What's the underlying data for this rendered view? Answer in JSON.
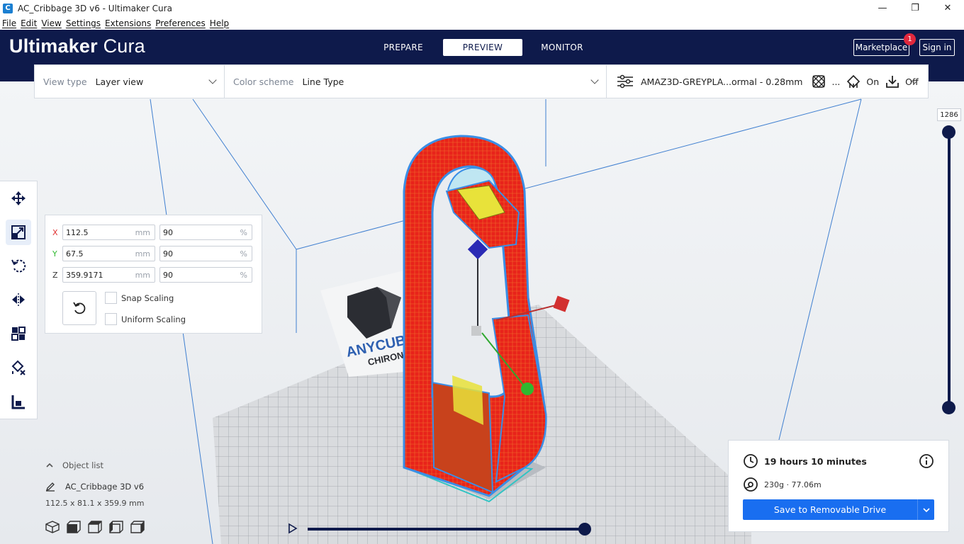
{
  "window": {
    "title": "AC_Cribbage 3D v6 - Ultimaker Cura",
    "app_icon": "C",
    "controls": {
      "minimize": "—",
      "maximize": "❐",
      "close": "✕"
    }
  },
  "menu": [
    "File",
    "Edit",
    "View",
    "Settings",
    "Extensions",
    "Preferences",
    "Help"
  ],
  "header": {
    "brand_bold": "Ultimaker",
    "brand_light": "Cura",
    "stages": [
      "PREPARE",
      "PREVIEW",
      "MONITOR"
    ],
    "active_stage": "PREVIEW",
    "marketplace_label": "Marketplace",
    "marketplace_badge": "1",
    "signin_label": "Sign in"
  },
  "viewbar": {
    "view_type_label": "View type",
    "view_type_value": "Layer view",
    "color_scheme_label": "Color scheme",
    "color_scheme_value": "Line Type",
    "profile": "AMAZ3D-GREYPLA...ormal - 0.28mm",
    "infill_value": "...",
    "support_value": "On",
    "adhesion_value": "Off"
  },
  "scale_tool": {
    "x_label": "X",
    "x_mm": "112.5",
    "x_pct": "90",
    "y_label": "Y",
    "y_mm": "67.5",
    "y_pct": "90",
    "z_label": "Z",
    "z_mm": "359.9171",
    "z_pct": "90",
    "unit_mm": "mm",
    "unit_pct": "%",
    "snap_scaling": "Snap Scaling",
    "uniform_scaling": "Uniform Scaling",
    "axis_colors": {
      "x": "#e03030",
      "y": "#2fb82f",
      "z": "#333333"
    }
  },
  "layer_slider": {
    "current_layer": "1286"
  },
  "object_list": {
    "toggle_label": "Object list",
    "object_name": "AC_Cribbage 3D v6",
    "dimensions": "112.5 x 81.1 x 359.9 mm"
  },
  "print_info": {
    "time": "19 hours 10 minutes",
    "material": "230g · 77.06m",
    "save_label": "Save to Removable Drive"
  },
  "build_plate_logo": {
    "line1": "ANYCUBIC",
    "line2": "CHIRON"
  },
  "colors": {
    "header_bg": "#0e1a4b",
    "accent_blue": "#196ef0",
    "model_red": "#e8231a",
    "shell_blue": "#3a8ee6",
    "infill_yellow": "#e8e23a"
  },
  "icons": {
    "tools": [
      "move-icon",
      "scale-icon",
      "rotate-icon",
      "mirror-icon",
      "per-model-settings-icon",
      "support-blocker-icon",
      "lay-flat-icon"
    ],
    "viewbar": [
      "settings-sliders-icon",
      "infill-icon",
      "support-icon",
      "adhesion-icon"
    ],
    "camera_views": [
      "3d-view-icon",
      "front-view-icon",
      "top-view-icon",
      "left-view-icon",
      "right-view-icon"
    ]
  }
}
